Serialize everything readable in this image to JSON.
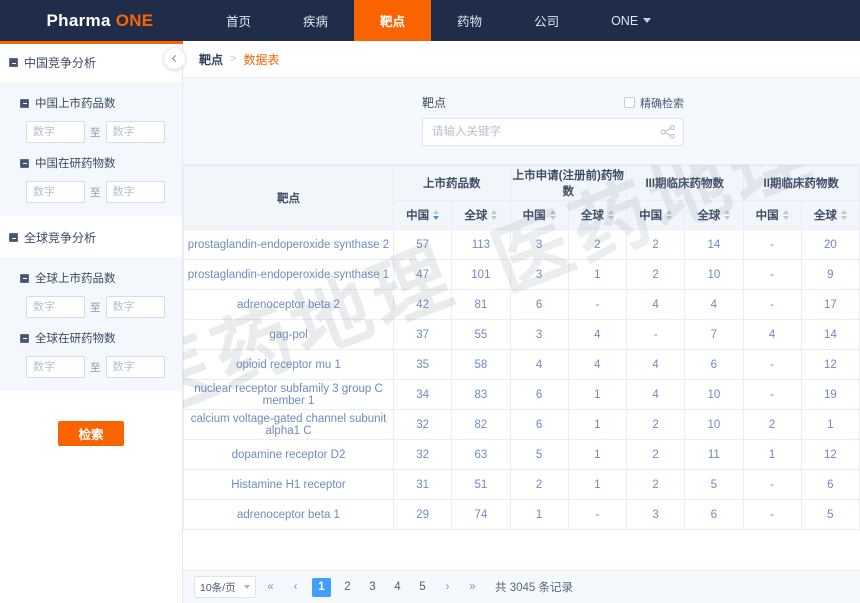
{
  "navbar": {
    "brand": "Pharma",
    "brand_accent": "ONE",
    "accent_color": "#f96400",
    "bg_color": "#1f2d4a",
    "items": [
      {
        "label": "首页",
        "active": false
      },
      {
        "label": "疾病",
        "active": false
      },
      {
        "label": "靶点",
        "active": true
      },
      {
        "label": "药物",
        "active": false
      },
      {
        "label": "公司",
        "active": false
      },
      {
        "label": "ONE",
        "active": false,
        "has_caret": true
      }
    ]
  },
  "sidebar": {
    "collapse_icon": "chevron-left-icon",
    "groups": [
      {
        "title": "中国竞争分析",
        "subgroups": [
          {
            "title": "中国上市药品数",
            "from_placeholder": "数字",
            "to_label": "至",
            "to_placeholder": "数字",
            "from_value": "",
            "to_value": ""
          },
          {
            "title": "中国在研药物数",
            "from_placeholder": "数字",
            "to_label": "至",
            "to_placeholder": "数字",
            "from_value": "",
            "to_value": ""
          }
        ]
      },
      {
        "title": "全球竞争分析",
        "subgroups": [
          {
            "title": "全球上市药品数",
            "from_placeholder": "数字",
            "to_label": "至",
            "to_placeholder": "数字",
            "from_value": "",
            "to_value": ""
          },
          {
            "title": "全球在研药物数",
            "from_placeholder": "数字",
            "to_label": "至",
            "to_placeholder": "数字",
            "from_value": "",
            "to_value": ""
          }
        ]
      }
    ],
    "search_button": "检索"
  },
  "breadcrumb": {
    "root": "靶点",
    "separator": ">",
    "current": "数据表"
  },
  "search": {
    "label": "靶点",
    "exact_label": "精确检索",
    "exact_checked": false,
    "placeholder": "请输入关键字",
    "value": "",
    "icon": "share-nodes-icon"
  },
  "table": {
    "first_column": "靶点",
    "groups": [
      {
        "label": "上市药品数",
        "subs": [
          "中国",
          "全球"
        ],
        "active_sort": 0
      },
      {
        "label": "上市申请(注册前)药物数",
        "subs": [
          "中国",
          "全球"
        ],
        "active_sort": -1
      },
      {
        "label": "III期临床药物数",
        "subs": [
          "中国",
          "全球"
        ],
        "active_sort": -1
      },
      {
        "label": "II期临床药物数",
        "subs": [
          "中国",
          "全球"
        ],
        "active_sort": -1
      }
    ],
    "rows": [
      {
        "name": "prostaglandin-endoperoxide synthase 2",
        "values": [
          "57",
          "113",
          "3",
          "2",
          "2",
          "14",
          "-",
          "20"
        ]
      },
      {
        "name": "prostaglandin-endoperoxide synthase 1",
        "values": [
          "47",
          "101",
          "3",
          "1",
          "2",
          "10",
          "-",
          "9"
        ]
      },
      {
        "name": "adrenoceptor beta 2",
        "values": [
          "42",
          "81",
          "6",
          "-",
          "4",
          "4",
          "-",
          "17"
        ]
      },
      {
        "name": "gag-pol",
        "values": [
          "37",
          "55",
          "3",
          "4",
          "-",
          "7",
          "4",
          "14"
        ]
      },
      {
        "name": "opioid receptor mu 1",
        "values": [
          "35",
          "58",
          "4",
          "4",
          "4",
          "6",
          "-",
          "12"
        ]
      },
      {
        "name": "nuclear receptor subfamily 3 group C member 1",
        "values": [
          "34",
          "83",
          "6",
          "1",
          "4",
          "10",
          "-",
          "19"
        ]
      },
      {
        "name": "calcium voltage-gated channel subunit alpha1 C",
        "values": [
          "32",
          "82",
          "6",
          "1",
          "2",
          "10",
          "2",
          "1"
        ]
      },
      {
        "name": "dopamine receptor D2",
        "values": [
          "32",
          "63",
          "5",
          "1",
          "2",
          "11",
          "1",
          "12"
        ]
      },
      {
        "name": "Histamine H1 receptor",
        "values": [
          "31",
          "51",
          "2",
          "1",
          "2",
          "5",
          "-",
          "6"
        ]
      },
      {
        "name": "adrenoceptor beta 1",
        "values": [
          "29",
          "74",
          "1",
          "-",
          "3",
          "6",
          "-",
          "5"
        ]
      }
    ],
    "watermark": "医药地理"
  },
  "pagination": {
    "page_size": "10条/页",
    "first": "«",
    "prev": "‹",
    "pages": [
      "1",
      "2",
      "3",
      "4",
      "5"
    ],
    "current_page": "1",
    "next": "›",
    "last": "»",
    "total_text": "共 3045 条记录"
  }
}
